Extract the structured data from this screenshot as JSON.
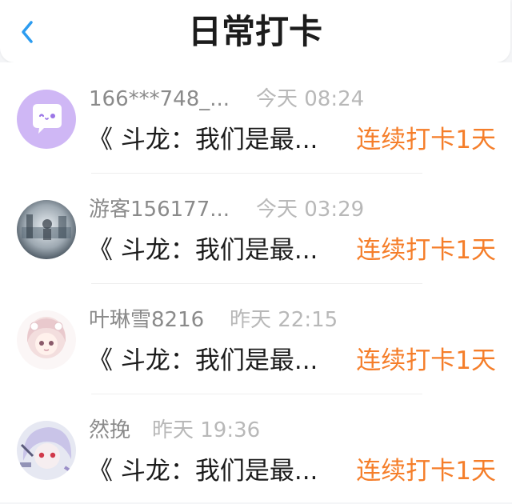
{
  "header": {
    "title": "日常打卡",
    "back_icon": "chevron-left-icon"
  },
  "entries": [
    {
      "name": "166***748_...",
      "time": "今天 08:24",
      "message": "《 斗龙：我们是最...",
      "streak": "连续打卡1天",
      "avatar": "purple-chat-avatar"
    },
    {
      "name": "游客156177...",
      "time": "今天 03:29",
      "message": "《 斗龙：我们是最...",
      "streak": "连续打卡1天",
      "avatar": "photo-avatar"
    },
    {
      "name": "叶琳雪8216",
      "time": "昨天 22:15",
      "message": "《 斗龙：我们是最...",
      "streak": "连续打卡1天",
      "avatar": "anime-girl-avatar"
    },
    {
      "name": "然挽",
      "time": "昨天 19:36",
      "message": "《 斗龙：我们是最...",
      "streak": "连续打卡1天",
      "avatar": "anime-character-avatar"
    }
  ],
  "colors": {
    "accent_blue": "#2c9cf0",
    "streak_orange": "#f57e2a",
    "name_gray": "#8a8a8a",
    "time_gray": "#b8b8b8"
  }
}
